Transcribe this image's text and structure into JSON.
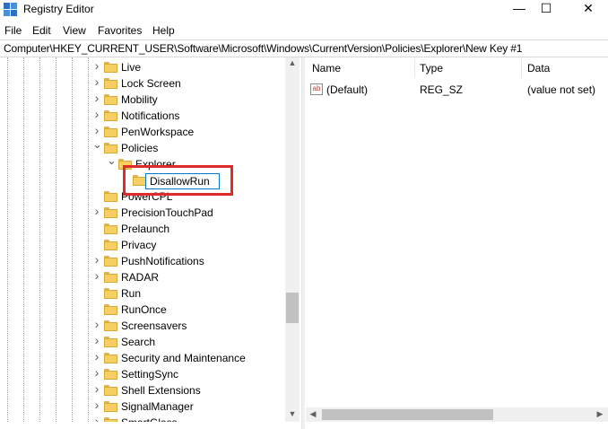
{
  "window": {
    "title": "Registry Editor",
    "minimize_glyph": "—",
    "maximize_glyph": "☐",
    "close_glyph": "✕"
  },
  "menu": [
    "File",
    "Edit",
    "View",
    "Favorites",
    "Help"
  ],
  "address": "Computer\\HKEY_CURRENT_USER\\Software\\Microsoft\\Windows\\CurrentVersion\\Policies\\Explorer\\New Key #1",
  "tree": {
    "items": [
      {
        "label": "Live",
        "expander": "collapsed",
        "level": 0
      },
      {
        "label": "Lock Screen",
        "expander": "collapsed",
        "level": 0
      },
      {
        "label": "Mobility",
        "expander": "collapsed",
        "level": 0
      },
      {
        "label": "Notifications",
        "expander": "collapsed",
        "level": 0
      },
      {
        "label": "PenWorkspace",
        "expander": "collapsed",
        "level": 0
      },
      {
        "label": "Policies",
        "expander": "expanded",
        "level": 0
      },
      {
        "label": "Explorer",
        "expander": "expanded",
        "level": 1
      },
      {
        "label": "",
        "expander": "none",
        "level": 2,
        "editing": true
      },
      {
        "label": "PowerCPL",
        "expander": "none",
        "level": 0
      },
      {
        "label": "PrecisionTouchPad",
        "expander": "collapsed",
        "level": 0
      },
      {
        "label": "Prelaunch",
        "expander": "none",
        "level": 0
      },
      {
        "label": "Privacy",
        "expander": "none",
        "level": 0
      },
      {
        "label": "PushNotifications",
        "expander": "collapsed",
        "level": 0
      },
      {
        "label": "RADAR",
        "expander": "collapsed",
        "level": 0
      },
      {
        "label": "Run",
        "expander": "none",
        "level": 0
      },
      {
        "label": "RunOnce",
        "expander": "none",
        "level": 0
      },
      {
        "label": "Screensavers",
        "expander": "collapsed",
        "level": 0
      },
      {
        "label": "Search",
        "expander": "collapsed",
        "level": 0
      },
      {
        "label": "Security and Maintenance",
        "expander": "collapsed",
        "level": 0
      },
      {
        "label": "SettingSync",
        "expander": "collapsed",
        "level": 0
      },
      {
        "label": "Shell Extensions",
        "expander": "collapsed",
        "level": 0
      },
      {
        "label": "SignalManager",
        "expander": "collapsed",
        "level": 0
      },
      {
        "label": "SmartGlass",
        "expander": "collapsed",
        "level": 0
      }
    ],
    "rename_value": "DisallowRun"
  },
  "values": {
    "columns": [
      "Name",
      "Type",
      "Data"
    ],
    "rows": [
      {
        "icon": "ab",
        "name": "(Default)",
        "type": "REG_SZ",
        "data": "(value not set)"
      }
    ]
  },
  "scroll_glyphs": {
    "up": "▲",
    "down": "▼",
    "left": "◀",
    "right": "▶"
  }
}
